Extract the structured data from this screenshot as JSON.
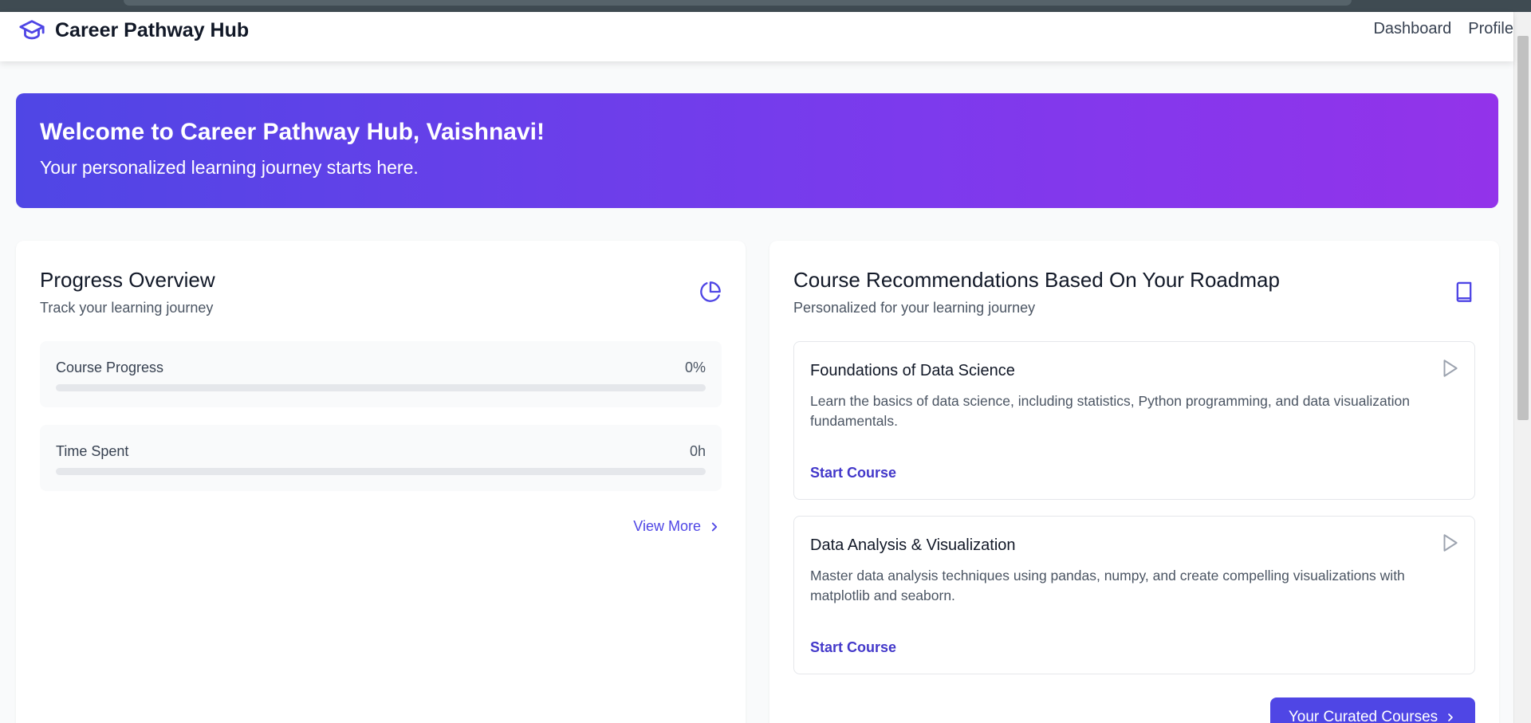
{
  "navbar": {
    "brand_icon": "graduation-cap-icon",
    "brand_name": "Career Pathway Hub",
    "links": [
      "Dashboard",
      "Profile"
    ]
  },
  "hero": {
    "title": "Welcome to Career Pathway Hub, Vaishnavi!",
    "subtitle": "Your personalized learning journey starts here."
  },
  "progress": {
    "title": "Progress Overview",
    "subtitle": "Track your learning journey",
    "icon": "pie-chart-icon",
    "stats": [
      {
        "label": "Course Progress",
        "value": "0%",
        "fill": 0
      },
      {
        "label": "Time Spent",
        "value": "0h",
        "fill": 0
      }
    ],
    "view_more": "View More"
  },
  "recommendations": {
    "title": "Course Recommendations Based On Your Roadmap",
    "subtitle": "Personalized for your learning journey",
    "icon": "book-icon",
    "courses": [
      {
        "title": "Foundations of Data Science",
        "description": "Learn the basics of data science, including statistics, Python programming, and data visualization fundamentals.",
        "action": "Start Course"
      },
      {
        "title": "Data Analysis & Visualization",
        "description": "Master data analysis techniques using pandas, numpy, and create compelling visualizations with matplotlib and seaborn.",
        "action": "Start Course"
      }
    ],
    "curated_button": "Your Curated Courses"
  },
  "colors": {
    "accent": "#4f46e5",
    "hero_start": "#4f46e5",
    "hero_end": "#9333ea"
  }
}
